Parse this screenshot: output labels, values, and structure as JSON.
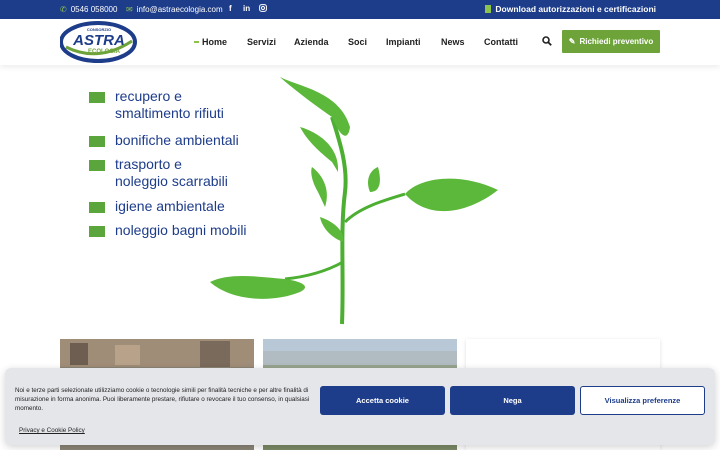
{
  "topbar": {
    "phone": "0546 058000",
    "email": "info@astraecologia.com",
    "social": [
      "f",
      "in",
      "ig"
    ],
    "download_label": "Download autorizzazioni e certificazioni"
  },
  "logo": {
    "small_text": "CONSORZIO",
    "main_text": "ASTRA",
    "sub_text": "ECOLOGIA"
  },
  "nav": {
    "items": [
      {
        "label": "Home"
      },
      {
        "label": "Servizi"
      },
      {
        "label": "Azienda"
      },
      {
        "label": "Soci"
      },
      {
        "label": "Impianti"
      },
      {
        "label": "News"
      },
      {
        "label": "Contatti"
      }
    ],
    "cta_label": "Richiedi preventivo"
  },
  "hero": {
    "items": [
      {
        "line1": "recupero e",
        "line2": "smaltimento rifiuti"
      },
      {
        "line1": "bonifiche ambientali",
        "line2": ""
      },
      {
        "line1": "trasporto e",
        "line2": "noleggio scarrabili"
      },
      {
        "line1": "igiene ambientale",
        "line2": ""
      },
      {
        "line1": "noleggio bagni mobili",
        "line2": ""
      }
    ]
  },
  "cookie": {
    "text": "Noi e terze parti selezionate utilizziamo cookie o tecnologie simili per finalità tecniche e per altre finalità di misurazione in forma anonima. Puoi liberamente prestare, rifiutare o revocare il tuo consenso, in qualsiasi momento.",
    "policy_link": "Privacy e Cookie Policy",
    "accept": "Accetta cookie",
    "deny": "Nega",
    "preferences": "Visualizza preferenze"
  },
  "colors": {
    "brand_blue": "#1d3c8a",
    "brand_green": "#6ea33a",
    "leaf_green": "#4caf32"
  }
}
